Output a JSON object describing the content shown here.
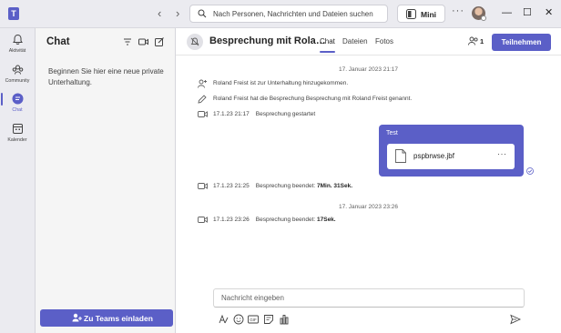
{
  "titlebar": {
    "back": "‹",
    "forward": "›",
    "search_placeholder": "Nach Personen, Nachrichten und Dateien suchen",
    "mini_label": "Mini",
    "more": "···",
    "minimize": "—",
    "maximize": "☐",
    "close": "✕"
  },
  "rail": {
    "items": [
      {
        "label": "Aktivität",
        "icon": "bell-icon"
      },
      {
        "label": "Community",
        "icon": "community-icon"
      },
      {
        "label": "Chat",
        "icon": "chat-icon",
        "active": true
      },
      {
        "label": "Kalender",
        "icon": "calendar-icon"
      }
    ]
  },
  "chatlist": {
    "title": "Chat",
    "hint": "Beginnen Sie hier eine neue private Unterhaltung.",
    "invite_label": "Zu Teams einladen"
  },
  "conversation": {
    "title": "Besprechung mit Rola…",
    "tabs": [
      "Chat",
      "Dateien",
      "Fotos"
    ],
    "participants_count": "1",
    "join_label": "Teilnehmen",
    "date1": "17. Januar 2023 21:17",
    "events1": [
      {
        "icon": "person-add-icon",
        "text": "Roland Freist ist zur Unterhaltung hinzugekommen."
      },
      {
        "icon": "pencil-icon",
        "text": "Roland Freist hat die Besprechung Besprechung mit Roland Freist genannt."
      },
      {
        "icon": "video-camera-icon",
        "time": "17.1.23 21:17",
        "text": "Besprechung gestartet"
      }
    ],
    "bubble": {
      "title": "Test",
      "file_name": "pspbrwse.jbf",
      "more": "···"
    },
    "events2": [
      {
        "icon": "video-camera-icon",
        "time": "17.1.23 21:25",
        "text": "Besprechung beendet:",
        "duration": "7Min. 31Sek."
      }
    ],
    "date2": "17. Januar 2023 23:26",
    "events3": [
      {
        "icon": "video-camera-icon",
        "time": "17.1.23 23:26",
        "text": "Besprechung beendet:",
        "duration": "17Sek."
      }
    ],
    "composer_placeholder": "Nachricht eingeben"
  },
  "colors": {
    "accent": "#5b5fc7",
    "rail_bg": "#ebebf0",
    "panel_bg": "#f5f5f5"
  }
}
